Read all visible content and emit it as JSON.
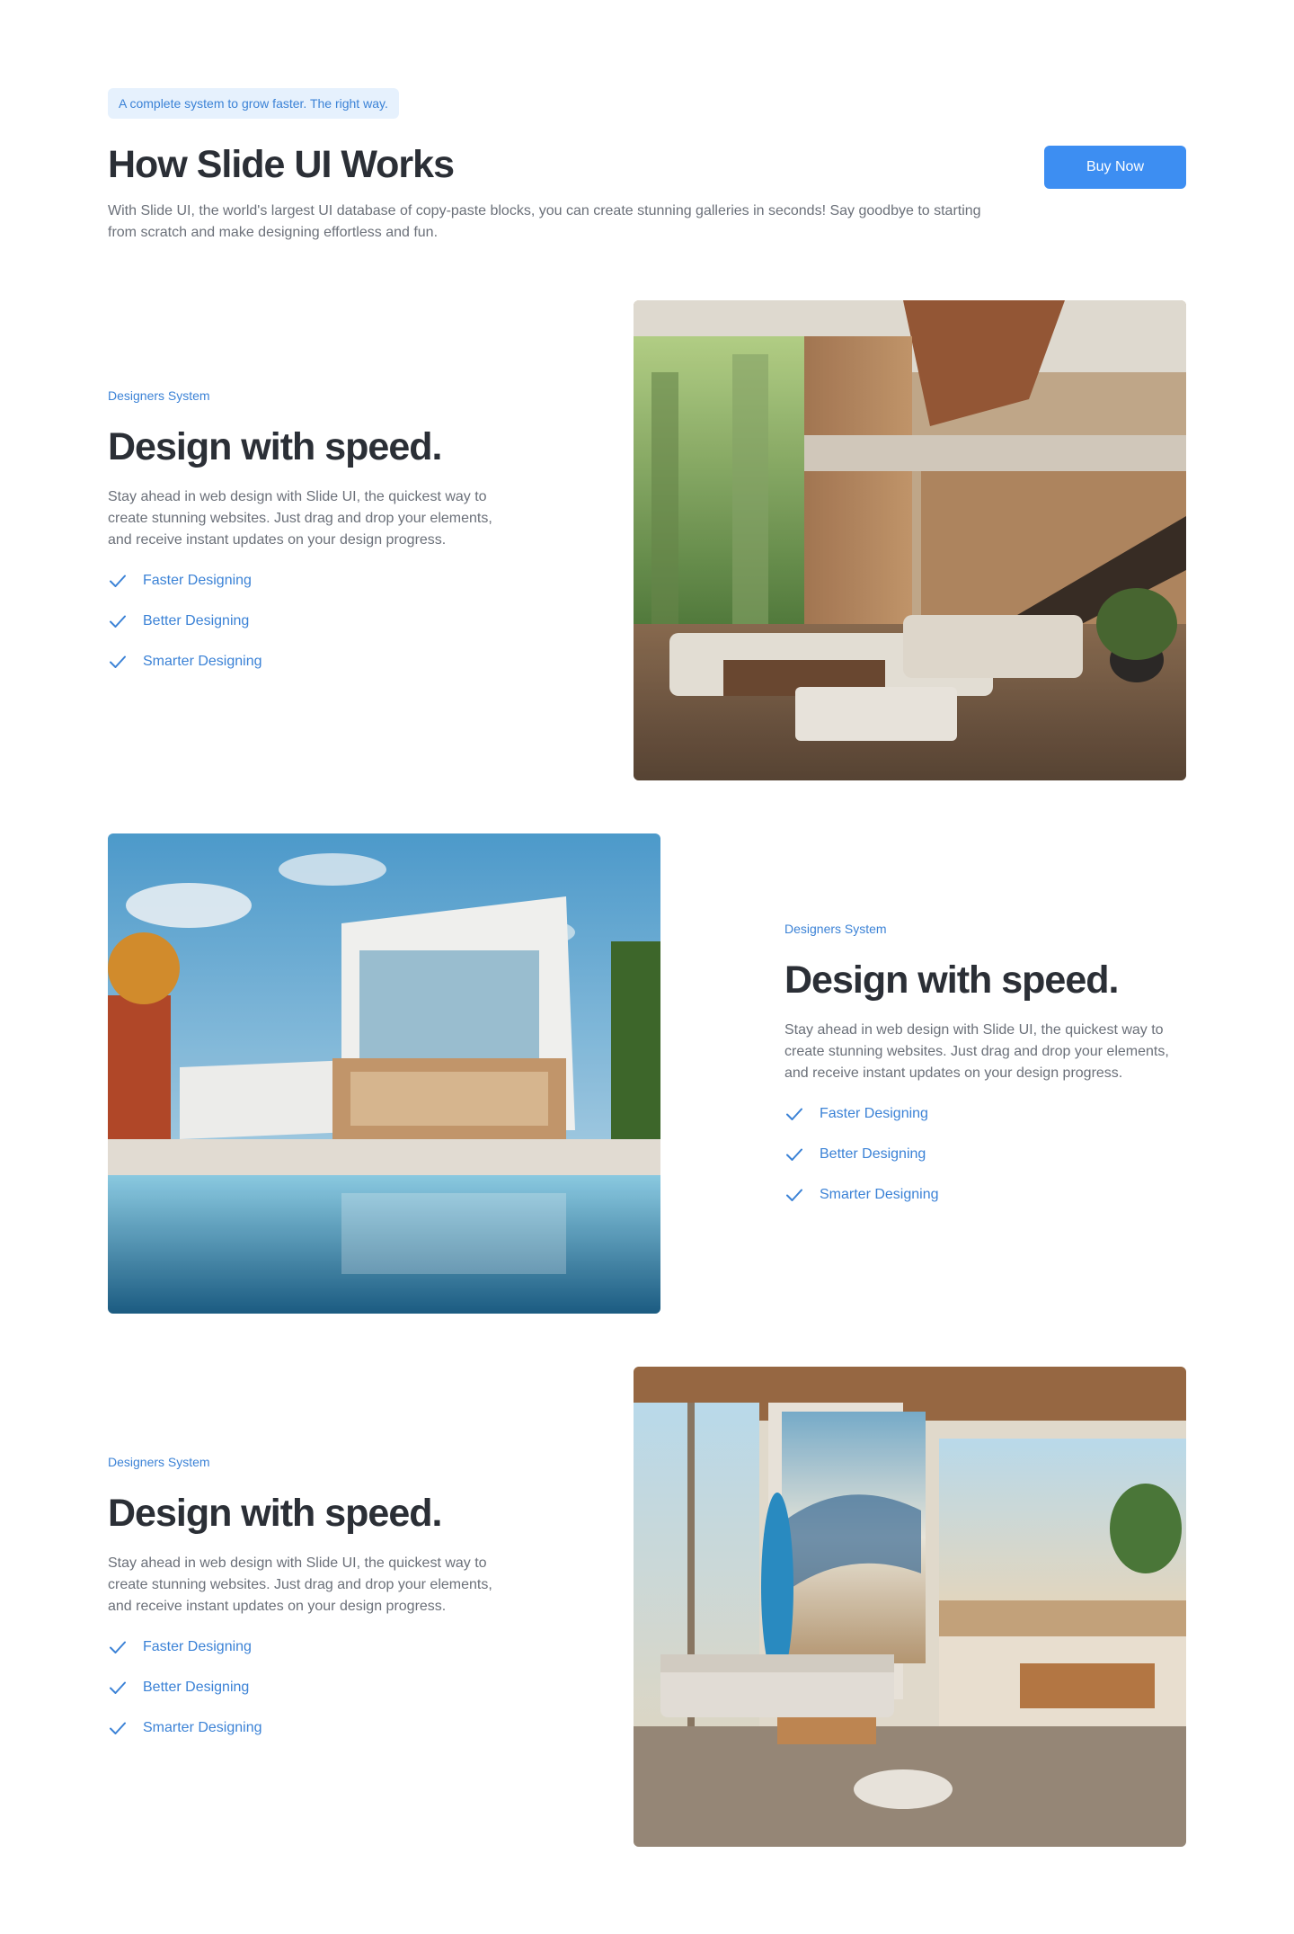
{
  "header": {
    "eyebrow": "A complete system to grow faster. The right way.",
    "title": "How Slide UI Works",
    "intro": "With Slide UI, the world's largest UI database of copy-paste blocks, you can create stunning galleries in seconds! Say goodbye to starting from scratch and make designing effortless and fun.",
    "buy_label": "Buy Now"
  },
  "colors": {
    "accent": "#3d8ef2",
    "accent_text": "#3b82d6",
    "pill_bg": "#e6f1fd",
    "heading": "#2b2f36",
    "body": "#6b7079"
  },
  "features": [
    {
      "tagline": "Designers System",
      "heading": "Design with speed.",
      "description": "Stay ahead in web design with Slide UI, the quickest way to create stunning websites. Just drag and drop your elements, and receive instant updates on your design progress.",
      "checklist": [
        "Faster Designing",
        "Better Designing",
        "Smarter Designing"
      ],
      "check_icon": "checkmark-icon",
      "image": "modern-living-room-photo"
    },
    {
      "tagline": "Designers System",
      "heading": "Design with speed.",
      "description": "Stay ahead in web design with Slide UI, the quickest way to create stunning websites. Just drag and drop your elements, and receive instant updates on your design progress.",
      "checklist": [
        "Faster Designing",
        "Better Designing",
        "Smarter Designing"
      ],
      "check_icon": "checkmark-icon",
      "image": "modern-villa-pool-photo"
    },
    {
      "tagline": "Designers System",
      "heading": "Design with speed.",
      "description": "Stay ahead in web design with Slide UI, the quickest way to create stunning websites. Just drag and drop your elements, and receive instant updates on your design progress.",
      "checklist": [
        "Faster Designing",
        "Better Designing",
        "Smarter Designing"
      ],
      "check_icon": "checkmark-icon",
      "image": "beach-house-interior-photo"
    }
  ]
}
